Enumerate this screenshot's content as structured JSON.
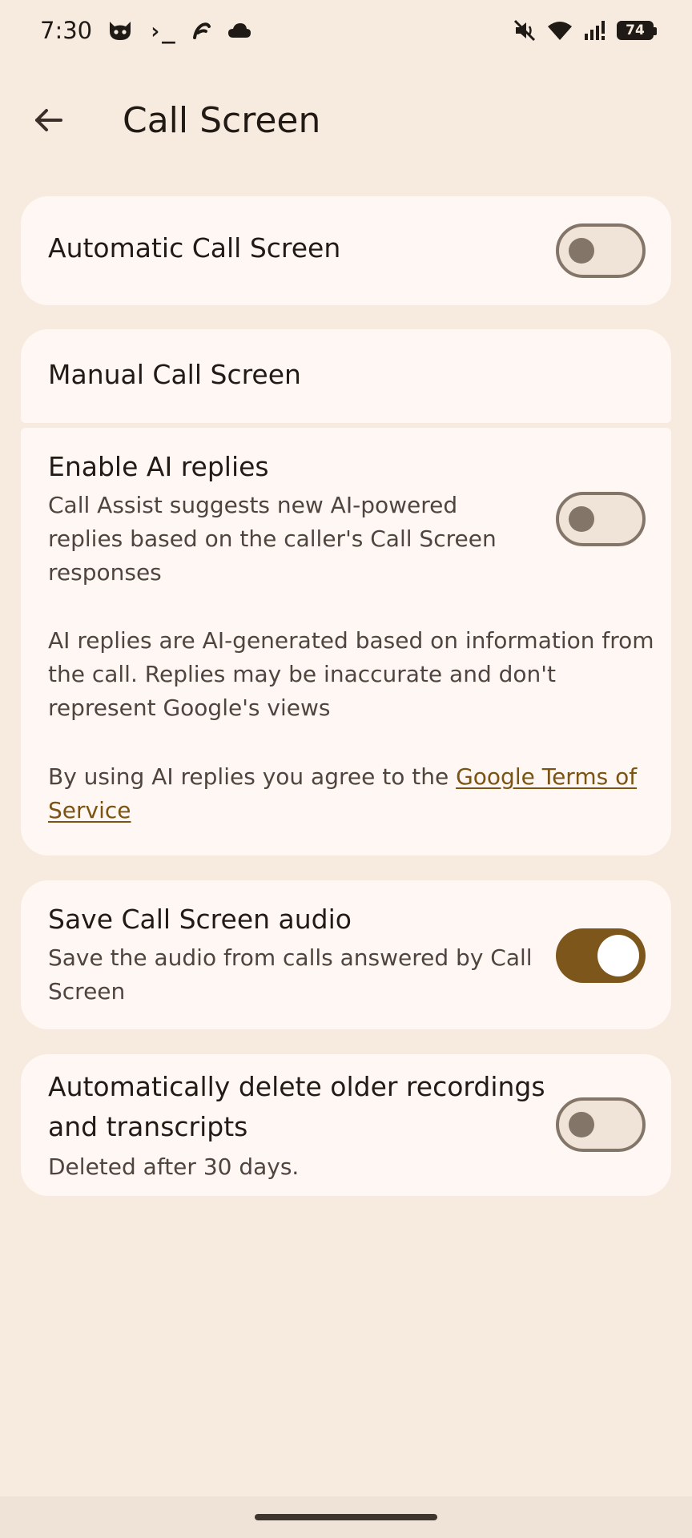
{
  "status_bar": {
    "time": "7:30",
    "terminal_glyph": "›_",
    "battery_level": "74"
  },
  "header": {
    "title": "Call Screen"
  },
  "settings": {
    "automatic": {
      "label": "Automatic Call Screen",
      "enabled": false
    },
    "manual": {
      "label": "Manual Call Screen"
    },
    "ai_replies": {
      "title": "Enable AI replies",
      "description_line1": "Call Assist suggests new AI-powered",
      "description_line2": "replies based on the caller's Call Screen",
      "description_line3": "responses",
      "enabled": false,
      "disclaimer_line1": "AI replies are AI-generated based on information from",
      "disclaimer_line2": "the call. Replies may be inaccurate and don't",
      "disclaimer_line3": "represent Google's views",
      "terms_prefix": "By using AI replies you agree to the ",
      "terms_link_part1": "Google Terms of",
      "terms_link_part2": "Service"
    },
    "save_audio": {
      "title": "Save Call Screen audio",
      "description_line1": "Save the audio from calls answered by Call",
      "description_line2": "Screen",
      "enabled": true
    },
    "auto_delete": {
      "title_line1": "Automatically delete older recordings",
      "title_line2": "and transcripts",
      "description": "Deleted after 30 days.",
      "enabled": false
    }
  },
  "colors": {
    "background": "#f7ebdf",
    "card": "#fff7f3",
    "accent": "#7d561b",
    "link": "#7b5312"
  }
}
